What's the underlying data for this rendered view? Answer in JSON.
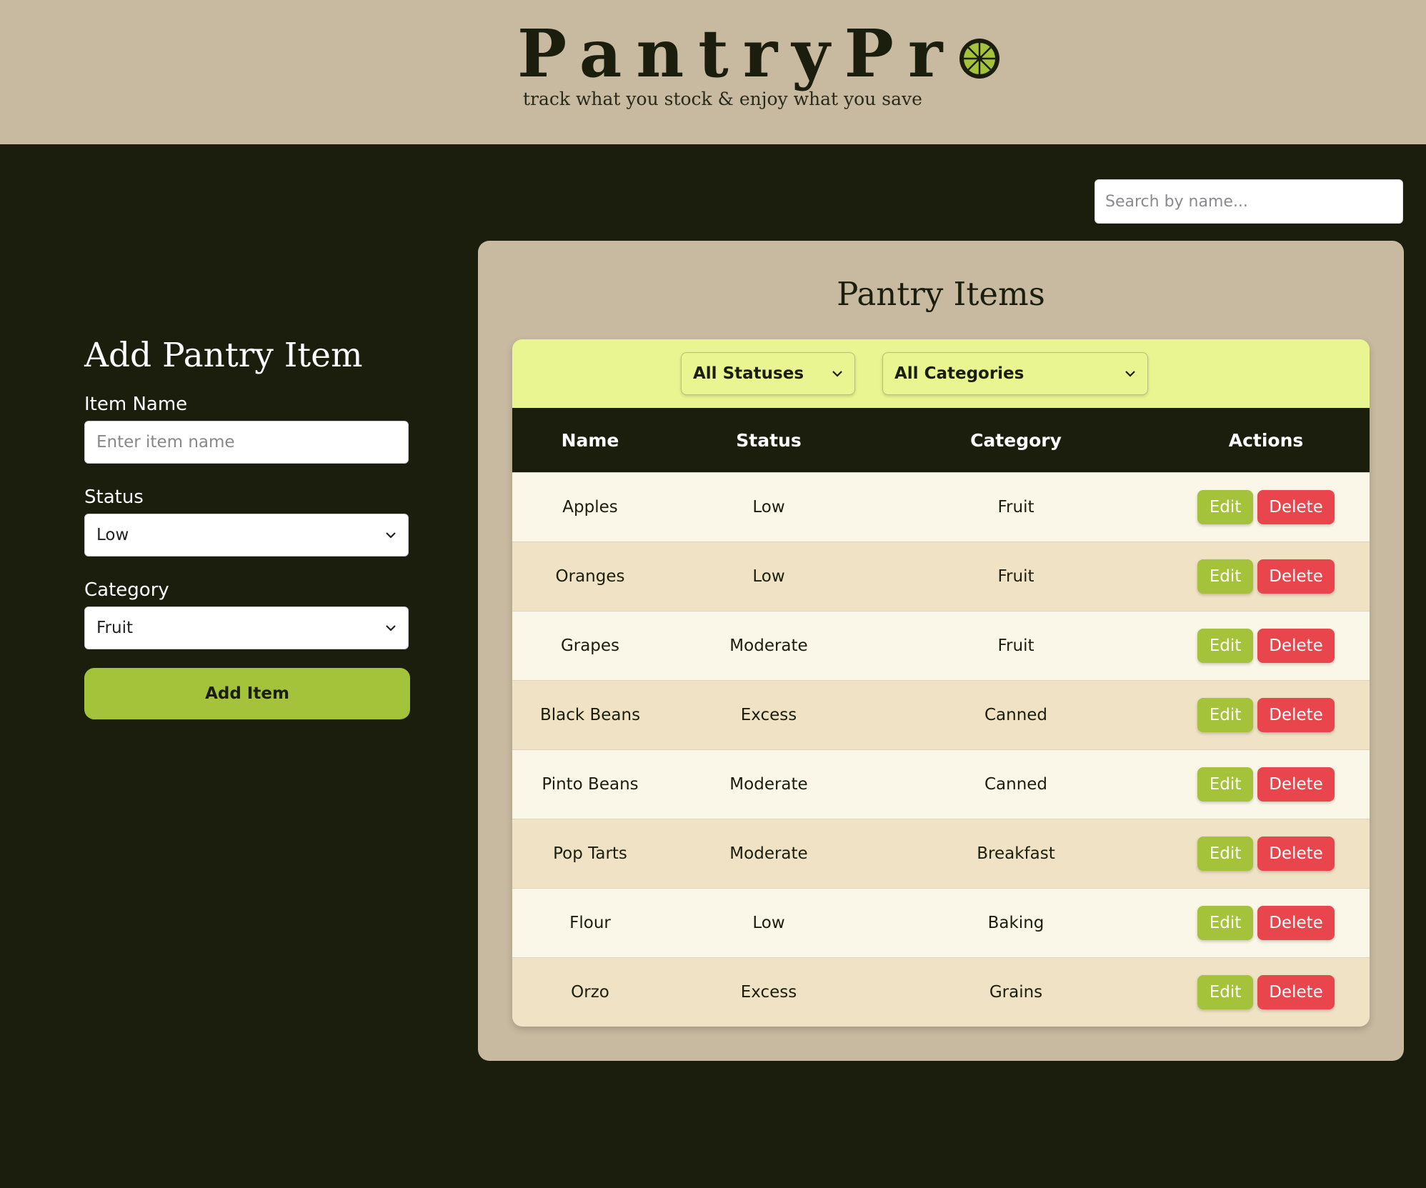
{
  "header": {
    "logo_text": "PantryPr",
    "tagline": "track what you stock & enjoy what you save"
  },
  "search": {
    "placeholder": "Search by name..."
  },
  "add_form": {
    "title": "Add Pantry Item",
    "item_name_label": "Item Name",
    "item_name_placeholder": "Enter item name",
    "status_label": "Status",
    "status_value": "Low",
    "category_label": "Category",
    "category_value": "Fruit",
    "submit_label": "Add Item"
  },
  "list": {
    "title": "Pantry Items",
    "status_filter": "All Statuses",
    "category_filter": "All Categories",
    "columns": [
      "Name",
      "Status",
      "Category",
      "Actions"
    ],
    "edit_label": "Edit",
    "delete_label": "Delete",
    "rows": [
      {
        "name": "Apples",
        "status": "Low",
        "category": "Fruit"
      },
      {
        "name": "Oranges",
        "status": "Low",
        "category": "Fruit"
      },
      {
        "name": "Grapes",
        "status": "Moderate",
        "category": "Fruit"
      },
      {
        "name": "Black Beans",
        "status": "Excess",
        "category": "Canned"
      },
      {
        "name": "Pinto Beans",
        "status": "Moderate",
        "category": "Canned"
      },
      {
        "name": "Pop Tarts",
        "status": "Moderate",
        "category": "Breakfast"
      },
      {
        "name": "Flour",
        "status": "Low",
        "category": "Baking"
      },
      {
        "name": "Orzo",
        "status": "Excess",
        "category": "Grains"
      }
    ]
  },
  "colors": {
    "header_bg": "#c8baa0",
    "page_bg": "#1b1e0c",
    "accent_green": "#a5c33a",
    "filter_bg": "#e9f590",
    "delete_red": "#e8454c"
  },
  "icons": {
    "logo": "lime-slice-icon",
    "select": "chevron-down-icon"
  }
}
